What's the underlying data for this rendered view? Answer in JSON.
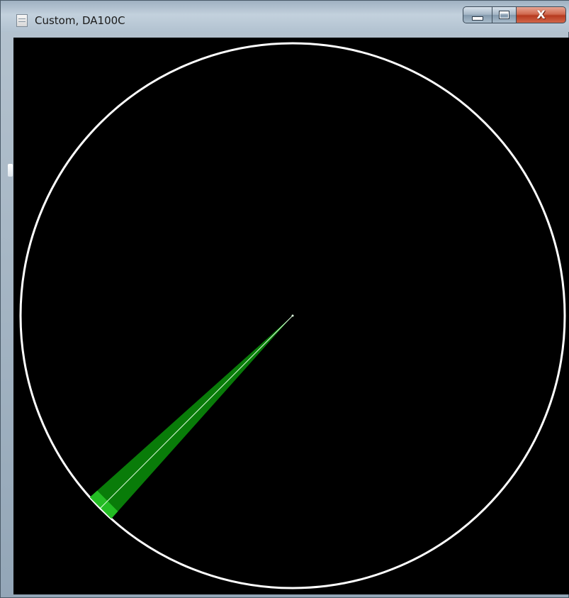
{
  "window": {
    "title": "Custom, DA100C",
    "icon": "document-icon",
    "buttons": {
      "minimize": "minimize-icon",
      "maximize": "maximize-icon",
      "close_label": "X"
    }
  },
  "display": {
    "background_color": "#000000",
    "ring_color": "#ffffff",
    "beam_color": "#0a8a0a",
    "beam_line_color": "#dfffdf",
    "beam_bearing_deg": 225
  }
}
